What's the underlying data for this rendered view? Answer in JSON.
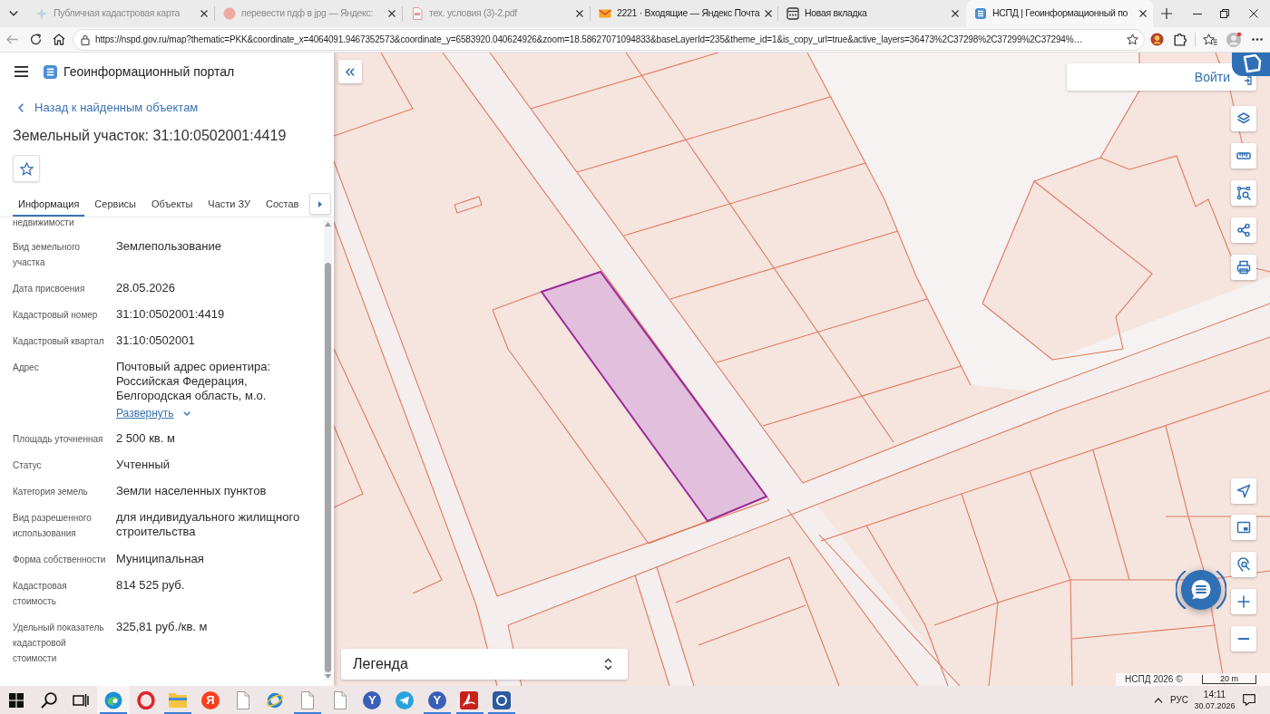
{
  "browser": {
    "tabs": [
      {
        "title": "Публичная кадастровая карта",
        "kind": "map",
        "sleeping": true,
        "selected": false
      },
      {
        "title": "перевести пдф в jpg — Яндекс:",
        "kind": "yandex",
        "sleeping": true,
        "selected": false
      },
      {
        "title": "тех. условия (3)-2.pdf",
        "kind": "pdf",
        "sleeping": true,
        "selected": false
      },
      {
        "title": "2221 · Входящие — Яндекс Почта",
        "kind": "mail",
        "sleeping": false,
        "selected": false
      },
      {
        "title": "Новая вкладка",
        "kind": "newtab",
        "sleeping": false,
        "selected": false
      },
      {
        "title": "НСПД | Геоинформационный по",
        "kind": "portal",
        "sleeping": false,
        "selected": true
      }
    ],
    "url": "https://nspd.gov.ru/map?thematic=PKK&coordinate_x=4064091.9467352573&coordinate_y=6583920.040624926&zoom=18.58627071094833&baseLayerId=235&theme_id=1&is_copy_url=true&active_layers=36473%2C37298%2C37299%2C37294%…"
  },
  "panel": {
    "app_title": "Геоинформационный портал",
    "back_link": "Назад к найденным объектам",
    "title": "Земельный участок: 31:10:0502001:4419",
    "tabs": [
      {
        "label": "Информация",
        "selected": true
      },
      {
        "label": "Сервисы",
        "selected": false
      },
      {
        "label": "Объекты",
        "selected": false
      },
      {
        "label": "Части ЗУ",
        "selected": false
      },
      {
        "label": "Состав",
        "selected": false
      }
    ],
    "fields": [
      {
        "label": "недвижимости"
      },
      {
        "label": "Вид земельного\nучастка",
        "value": "Землепользование"
      },
      {
        "label": "Дата присвоения",
        "value": "28.05.2026"
      },
      {
        "label": "Кадастровый номер",
        "value": "31:10:0502001:4419"
      },
      {
        "label": "Кадастровый квартал",
        "value": "31:10:0502001"
      },
      {
        "label": "Адрес",
        "value": "Почтовый адрес ориентира:\nРоссийская Федерация,\nБелгородская область, м.о.",
        "link": "Развернуть"
      },
      {
        "label": "Площадь уточненная",
        "value": "2 500 кв. м"
      },
      {
        "label": "Статус",
        "value": "Учтенный"
      },
      {
        "label": "Категория земель",
        "value": "Земли населенных пунктов"
      },
      {
        "label": "Вид разрешенного\nиспользования",
        "value": "для индивидуального жилищного\nстроительства"
      },
      {
        "label": "Форма собственности",
        "value": "Муниципальная"
      },
      {
        "label": "Кадастровая\nстоимость",
        "value": "814 525 руб."
      },
      {
        "label": "Удельный показатель\nкадастровой\nстоимости",
        "value": "325,81 руб./кв. м"
      }
    ]
  },
  "map": {
    "login": "Войти",
    "legend": "Легенда",
    "attribution": "НСПД 2026 ©",
    "scale": "20 m"
  },
  "taskbar": {
    "apps": [
      {
        "kind": "start",
        "running": false,
        "focused": false
      },
      {
        "kind": "search",
        "running": false,
        "focused": false
      },
      {
        "kind": "taskview",
        "running": false,
        "focused": false
      },
      {
        "kind": "edge",
        "running": true,
        "focused": true
      },
      {
        "kind": "opera",
        "running": false,
        "focused": false
      },
      {
        "kind": "explorer",
        "running": true,
        "focused": false
      },
      {
        "kind": "yandex",
        "label": "Я",
        "running": false,
        "focused": false
      },
      {
        "kind": "file",
        "running": false,
        "focused": false
      },
      {
        "kind": "ie",
        "running": false,
        "focused": false
      },
      {
        "kind": "file",
        "running": true,
        "focused": false
      },
      {
        "kind": "file",
        "running": false,
        "focused": false
      },
      {
        "kind": "ybrowser",
        "label": "Y",
        "running": false,
        "focused": false
      },
      {
        "kind": "telegram",
        "running": false,
        "focused": false
      },
      {
        "kind": "ybrowser",
        "label": "Y",
        "running": true,
        "focused": false
      },
      {
        "kind": "acrobat",
        "running": true,
        "focused": false
      },
      {
        "kind": "app",
        "running": true,
        "focused": false
      }
    ],
    "language": "РУС",
    "time": "14:11",
    "date": "30.07.2026"
  }
}
